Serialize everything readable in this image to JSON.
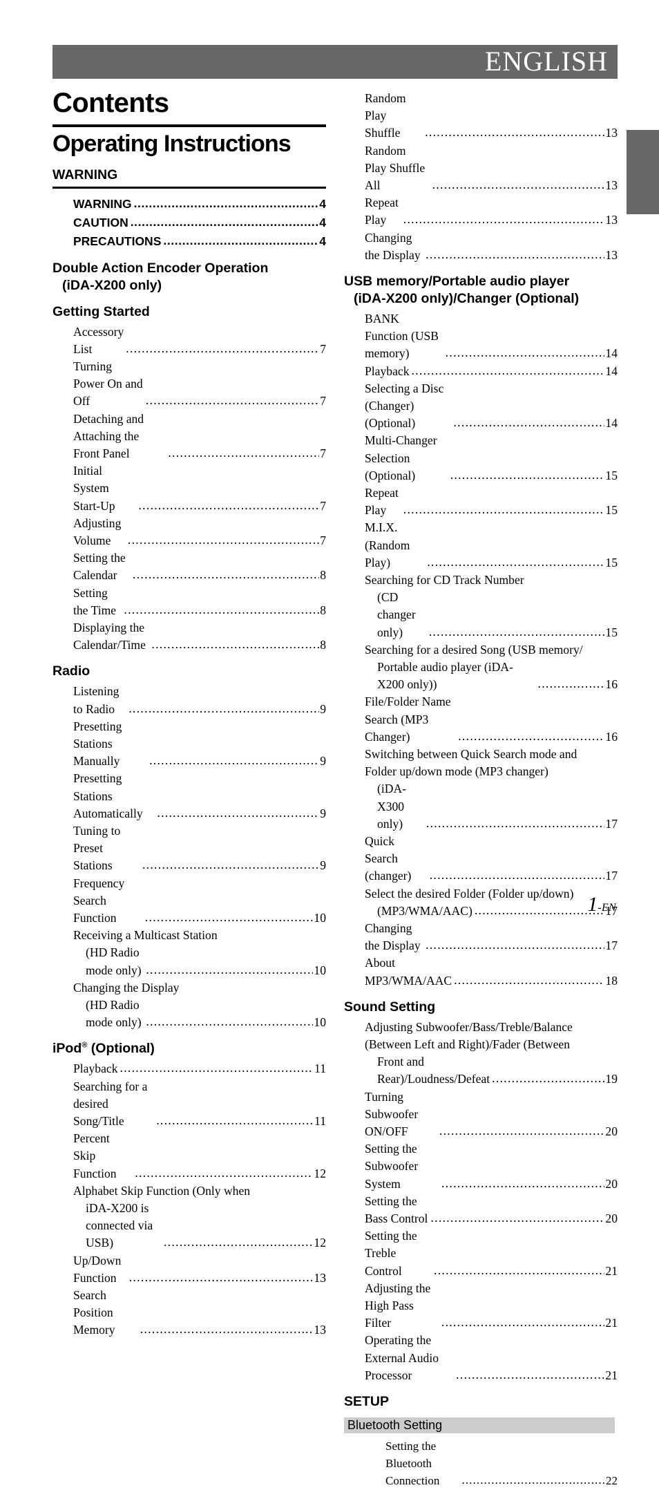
{
  "header": {
    "language_label": "ENGLISH",
    "band_color": "#676767",
    "edge_tab_color": "#676767"
  },
  "title": {
    "contents": "Contents",
    "operating_instructions": "Operating Instructions"
  },
  "footer": {
    "page_number": "1",
    "page_suffix": "-EN"
  },
  "left_column": {
    "sections": [
      {
        "heading": "WARNING",
        "ruled": true,
        "style": "sans-bold",
        "entries": [
          {
            "label": "WARNING",
            "page": "4"
          },
          {
            "label": "CAUTION",
            "page": "4"
          },
          {
            "label": "PRECAUTIONS",
            "page": "4"
          }
        ]
      },
      {
        "heading": "Double Action Encoder Operation",
        "heading_line2": "(iDA-X200 only)",
        "entries": []
      },
      {
        "heading": "Getting Started",
        "entries": [
          {
            "label": "Accessory List",
            "page": "7"
          },
          {
            "label": "Turning Power On and Off",
            "page": "7"
          },
          {
            "label": "Detaching and Attaching the Front Panel",
            "page": "7"
          },
          {
            "label": "Initial System Start-Up",
            "page": "7"
          },
          {
            "label": "Adjusting Volume",
            "page": "7"
          },
          {
            "label": "Setting the Calendar",
            "page": "8"
          },
          {
            "label": "Setting the Time",
            "page": "8"
          },
          {
            "label": "Displaying the Calendar/Time",
            "page": "8"
          }
        ]
      },
      {
        "heading": "Radio",
        "entries": [
          {
            "label": "Listening to Radio",
            "page": "9"
          },
          {
            "label": "Presetting Stations Manually",
            "page": "9"
          },
          {
            "label": "Presetting Stations Automatically",
            "page": "9"
          },
          {
            "label": "Tuning to Preset Stations",
            "page": "9"
          },
          {
            "label": "Frequency Search Function",
            "page": "10"
          },
          {
            "label": "Receiving a Multicast Station",
            "label_line2": "(HD Radio mode only)",
            "page": "10"
          },
          {
            "label": "Changing the Display",
            "label_line2": "(HD Radio mode only)",
            "page": "10"
          }
        ]
      },
      {
        "heading": "iPod® (Optional)",
        "heading_base": "iPod",
        "heading_sup": "®",
        "heading_rest": " (Optional)",
        "entries": [
          {
            "label": "Playback",
            "page": "11"
          },
          {
            "label": "Searching for a desired Song/Title",
            "page": "11"
          },
          {
            "label": "Percent Skip Function",
            "page": "12"
          },
          {
            "label": "Alphabet Skip Function (Only when",
            "label_line2": "iDA-X200 is connected via USB)",
            "page": "12"
          },
          {
            "label": "Up/Down Function",
            "page": "13"
          },
          {
            "label": "Search Position Memory",
            "page": "13"
          }
        ]
      }
    ]
  },
  "right_column": {
    "continued_entries": [
      {
        "label": "Random Play Shuffle",
        "page": "13"
      },
      {
        "label": "Random Play Shuffle All",
        "page": "13"
      },
      {
        "label": "Repeat Play",
        "page": "13"
      },
      {
        "label": "Changing the Display",
        "page": "13"
      }
    ],
    "sections": [
      {
        "heading": "USB memory/Portable audio player",
        "heading_line2": "(iDA-X200 only)/Changer (Optional)",
        "entries": [
          {
            "label": "BANK Function (USB memory)",
            "page": "14"
          },
          {
            "label": "Playback",
            "page": "14"
          },
          {
            "label": "Selecting a Disc (Changer) (Optional)",
            "page": "14"
          },
          {
            "label": "Multi-Changer Selection (Optional)",
            "page": "15"
          },
          {
            "label": "Repeat Play",
            "page": "15"
          },
          {
            "label": "M.I.X. (Random Play)",
            "page": "15"
          },
          {
            "label": "Searching for CD Track Number",
            "label_line2": "(CD changer only)",
            "page": "15"
          },
          {
            "label": "Searching for a desired Song (USB memory/",
            "label_line2": "Portable audio player (iDA-X200 only))",
            "page": "16"
          },
          {
            "label": "File/Folder Name Search (MP3 Changer)",
            "page": "16"
          },
          {
            "label": "Switching between Quick Search mode and",
            "label_line2": "Folder up/down mode (MP3 changer)",
            "label_line3": "(iDA-X300 only)",
            "page": "17"
          },
          {
            "label": "Quick Search (changer)",
            "page": "17"
          },
          {
            "label": "Select the desired Folder (Folder up/down)",
            "label_line2": "(MP3/WMA/AAC)",
            "page": "17"
          },
          {
            "label": "Changing the Display",
            "page": "17"
          },
          {
            "label": "About MP3/WMA/AAC",
            "page": "18"
          }
        ]
      },
      {
        "heading": "Sound Setting",
        "entries": [
          {
            "label": "Adjusting Subwoofer/Bass/Treble/Balance",
            "label_line2": "(Between Left and Right)/Fader (Between",
            "label_line3": "Front and Rear)/Loudness/Defeat",
            "page": "19"
          },
          {
            "label": "Turning Subwoofer ON/OFF",
            "page": "20"
          },
          {
            "label": "Setting the Subwoofer System",
            "page": "20"
          },
          {
            "label": "Setting the Bass Control",
            "page": "20"
          },
          {
            "label": "Setting the Treble Control",
            "page": "21"
          },
          {
            "label": "Adjusting the High Pass Filter",
            "page": "21"
          },
          {
            "label": "Operating the External Audio Processor",
            "page": "21"
          }
        ]
      },
      {
        "heading": "SETUP",
        "band": "Bluetooth Setting",
        "band_color": "#cccccc",
        "entries_deep": [
          {
            "label": "Setting the Bluetooth Connection",
            "page": "22"
          }
        ]
      }
    ]
  }
}
